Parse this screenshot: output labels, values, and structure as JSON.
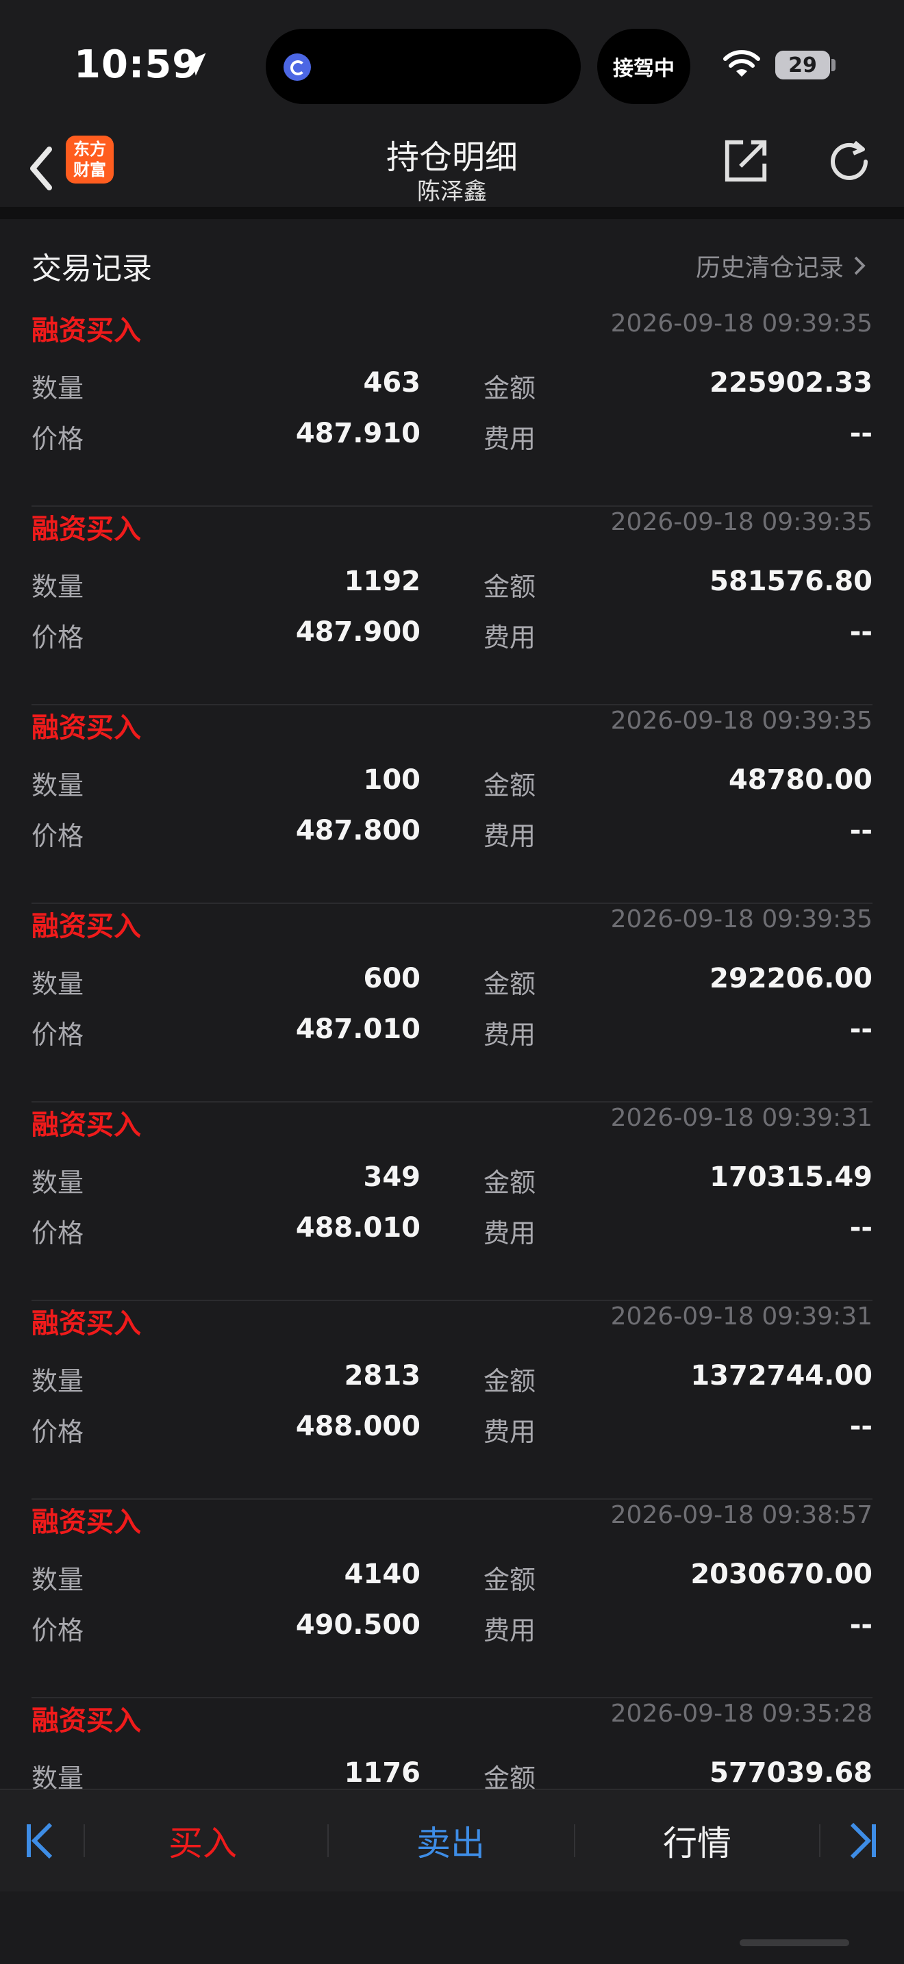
{
  "status_bar": {
    "time": "10:59",
    "pill_label": "接驾中",
    "battery": "29"
  },
  "nav": {
    "logo_line1": "东方",
    "logo_line2": "财富",
    "title": "持仓明细",
    "subtitle": "陈泽鑫"
  },
  "section": {
    "title": "交易记录",
    "history_link": "历史清仓记录"
  },
  "labels": {
    "qty": "数量",
    "amount": "金额",
    "price": "价格",
    "fee": "费用"
  },
  "records": [
    {
      "type": "融资买入",
      "time": "2026-09-18 09:39:35",
      "qty": "463",
      "amount": "225902.33",
      "price": "487.910",
      "fee": "--"
    },
    {
      "type": "融资买入",
      "time": "2026-09-18 09:39:35",
      "qty": "1192",
      "amount": "581576.80",
      "price": "487.900",
      "fee": "--"
    },
    {
      "type": "融资买入",
      "time": "2026-09-18 09:39:35",
      "qty": "100",
      "amount": "48780.00",
      "price": "487.800",
      "fee": "--"
    },
    {
      "type": "融资买入",
      "time": "2026-09-18 09:39:35",
      "qty": "600",
      "amount": "292206.00",
      "price": "487.010",
      "fee": "--"
    },
    {
      "type": "融资买入",
      "time": "2026-09-18 09:39:31",
      "qty": "349",
      "amount": "170315.49",
      "price": "488.010",
      "fee": "--"
    },
    {
      "type": "融资买入",
      "time": "2026-09-18 09:39:31",
      "qty": "2813",
      "amount": "1372744.00",
      "price": "488.000",
      "fee": "--"
    },
    {
      "type": "融资买入",
      "time": "2026-09-18 09:38:57",
      "qty": "4140",
      "amount": "2030670.00",
      "price": "490.500",
      "fee": "--"
    },
    {
      "type": "融资买入",
      "time": "2026-09-18 09:35:28",
      "qty": "1176",
      "amount": "577039.68",
      "price": "",
      "fee": ""
    }
  ],
  "toolbar": {
    "buy": "买入",
    "sell": "卖出",
    "quote": "行情"
  },
  "colors": {
    "buy_red": "#f01b1b",
    "sell_blue": "#3e8de6",
    "logo_orange": "#ff5d1f",
    "background": "#1b1b1d"
  }
}
